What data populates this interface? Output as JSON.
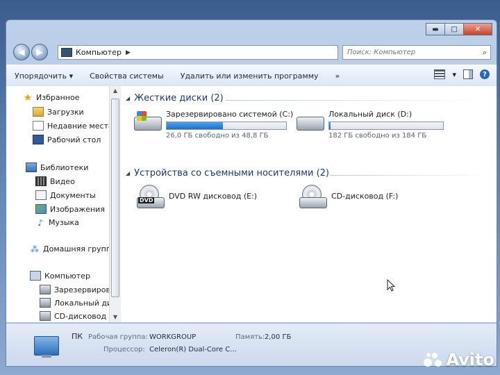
{
  "window": {
    "caption_buttons": {
      "minimize": "▬",
      "maximize": "□",
      "close": "✕"
    }
  },
  "navbar": {
    "back_icon": "◀",
    "forward_icon": "▶",
    "address": "Компьютер",
    "address_separator": "▶",
    "refresh_icon": "↻",
    "search_placeholder": "Поиск: Компьютер",
    "search_icon": "⌕"
  },
  "toolbar": {
    "organize": "Упорядочить ▾",
    "system_properties": "Свойства системы",
    "uninstall": "Удалить или изменить программу",
    "more": "»",
    "view_dropdown": "▾",
    "help": "?"
  },
  "navpane": {
    "favorites": "Избранное",
    "downloads": "Загрузки",
    "recent": "Недавние места",
    "desktop": "Рабочий стол",
    "libraries": "Библиотеки",
    "video": "Видео",
    "documents": "Документы",
    "pictures": "Изображения",
    "music": "Музыка",
    "homegroup": "Домашняя группа",
    "computer": "Компьютер",
    "reserved": "Зарезервирован",
    "local": "Локальный диск",
    "cd": "CD-дисковод (F:"
  },
  "groups": {
    "hdd_header": "Жесткие диски (2)",
    "removable_header": "Устройства со съемными носителями (2)",
    "collapse_icon": "◢"
  },
  "drives": {
    "c": {
      "name": "Зарезервировано системой (C:)",
      "free": "26,0 ГБ свободно из 48,8 ГБ",
      "used_fraction": 0.47
    },
    "d": {
      "name": "Локальный диск (D:)",
      "free": "182 ГБ свободно из 184 ГБ",
      "used_fraction": 0.01
    },
    "e": {
      "name": "DVD RW дисковод (E:)",
      "badge": "DVD"
    },
    "f": {
      "name": "CD-дисковод (F:)"
    }
  },
  "details": {
    "name": "ПК",
    "workgroup_label": "Рабочая группа:",
    "workgroup": "WORKGROUP",
    "memory_label": "Память:",
    "memory": "2,00 ГБ",
    "cpu_label": "Процессор:",
    "cpu": "Celeron(R) Dual-Core C..."
  },
  "watermark": {
    "text": "Avito"
  },
  "colors": {
    "accent": "#1f6fc9",
    "header": "#1e3a6b"
  }
}
